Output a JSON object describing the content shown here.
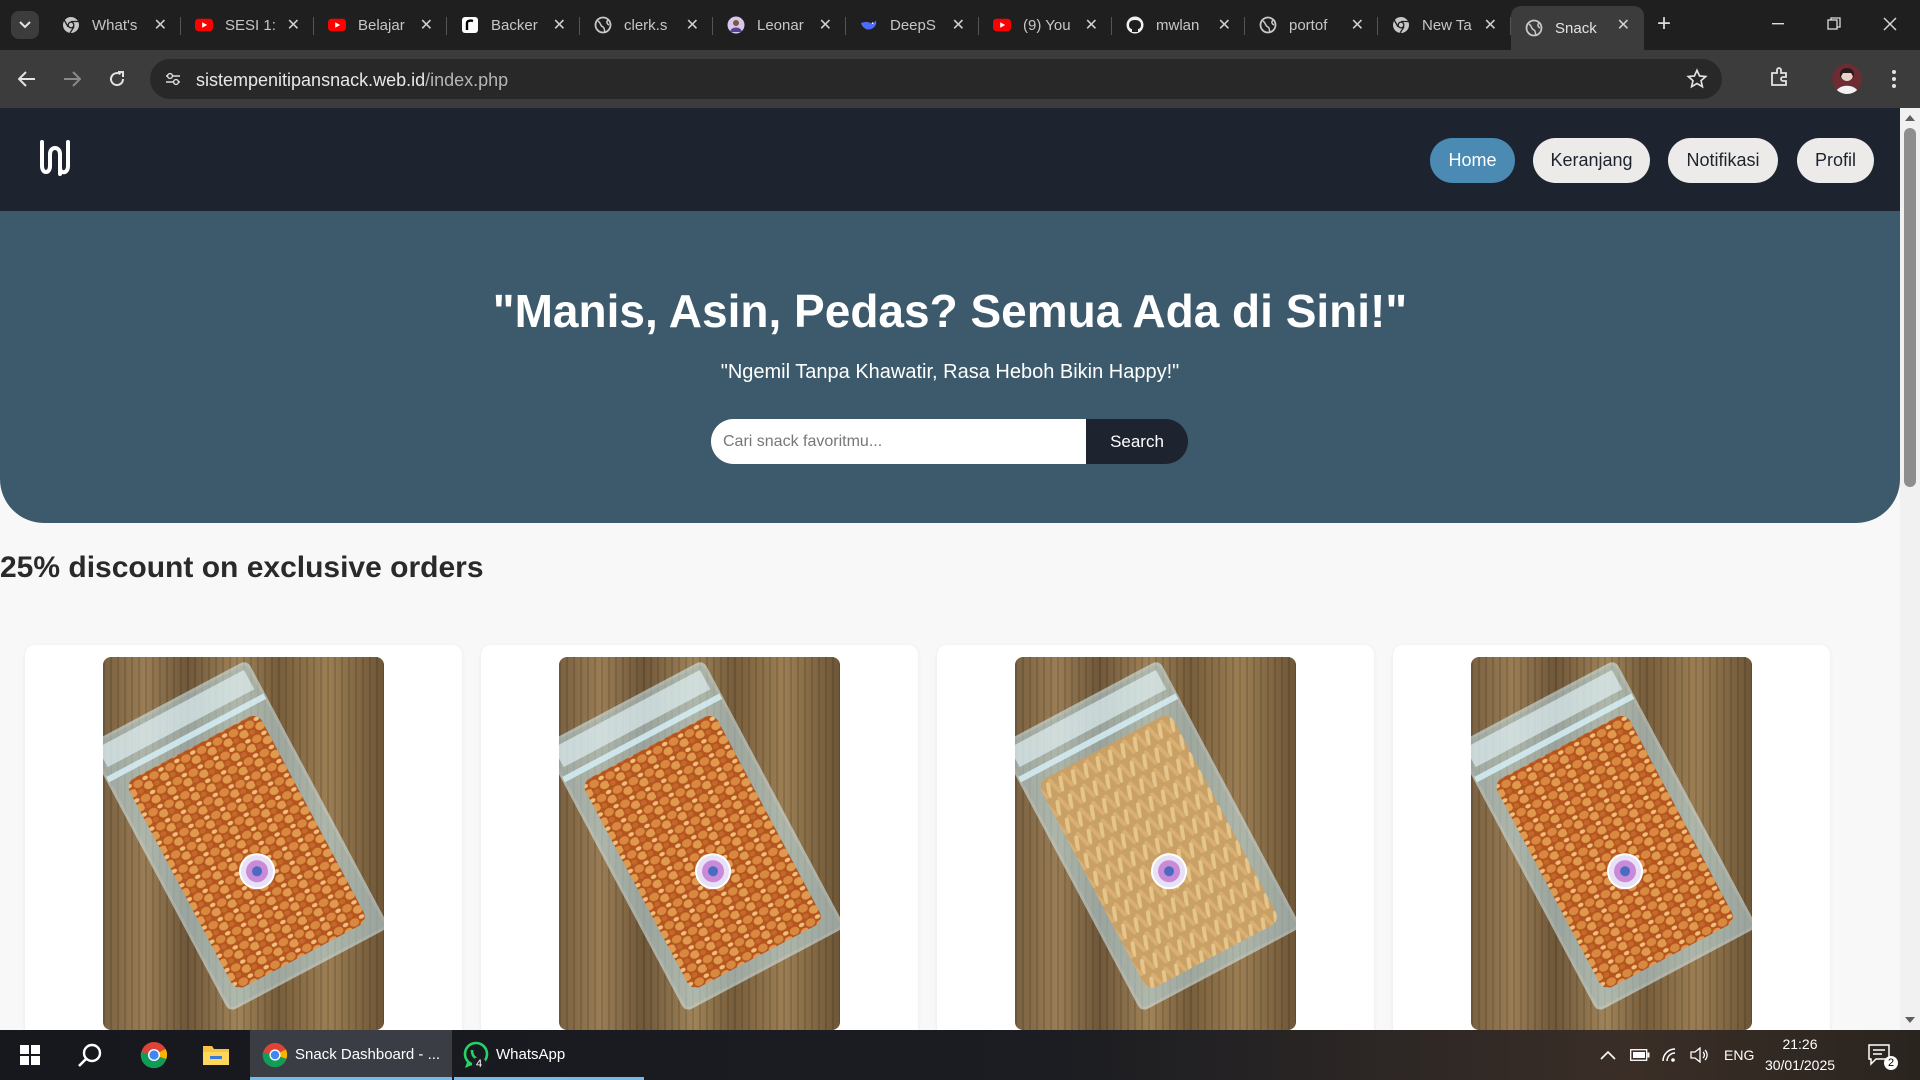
{
  "browser": {
    "tabs": [
      {
        "title": "What's",
        "icon": "chrome-icon",
        "active": false
      },
      {
        "title": "SESI 1:",
        "icon": "youtube-icon",
        "active": false
      },
      {
        "title": "Belajar",
        "icon": "youtube-icon",
        "active": false
      },
      {
        "title": "Backer",
        "icon": "r-icon",
        "active": false
      },
      {
        "title": "clerk.s",
        "icon": "globe-icon",
        "active": false
      },
      {
        "title": "Leonar",
        "icon": "leonardo-icon",
        "active": false
      },
      {
        "title": "DeepS",
        "icon": "deepseek-icon",
        "active": false
      },
      {
        "title": "(9) You",
        "icon": "youtube-icon",
        "active": false
      },
      {
        "title": "mwlan",
        "icon": "github-icon",
        "active": false
      },
      {
        "title": "portof",
        "icon": "globe-icon",
        "active": false
      },
      {
        "title": "New Ta",
        "icon": "chrome-icon",
        "active": false
      },
      {
        "title": "Snack",
        "icon": "globe-icon",
        "active": true
      }
    ],
    "url": {
      "host": "sistempenitipansnack.web.id",
      "path": "/index.php"
    }
  },
  "site": {
    "nav": {
      "home": "Home",
      "cart": "Keranjang",
      "notifications": "Notifikasi",
      "profile": "Profil"
    },
    "hero": {
      "title": "\"Manis, Asin, Pedas? Semua Ada di Sini!\"",
      "subtitle": "\"Ngemil Tanpa Khawatir, Rasa Heboh Bikin Happy!\"",
      "search_placeholder": "Cari snack favoritmu...",
      "search_button": "Search"
    },
    "section_title": "25% discount on exclusive orders",
    "products": [
      {
        "kind": "peanut"
      },
      {
        "kind": "peanut"
      },
      {
        "kind": "stick"
      },
      {
        "kind": "peanut"
      }
    ]
  },
  "taskbar": {
    "apps": [
      {
        "label": "Snack Dashboard - ...",
        "icon": "chrome-icon"
      },
      {
        "label": "WhatsApp",
        "icon": "whatsapp-icon",
        "badge": "4"
      }
    ],
    "language": "ENG",
    "time": "21:26",
    "date": "30/01/2025",
    "notifications": "2"
  },
  "colors": {
    "nav_bg": "#1d2430",
    "hero_bg": "#3c5a6c",
    "accent": "#4a8ab3"
  }
}
